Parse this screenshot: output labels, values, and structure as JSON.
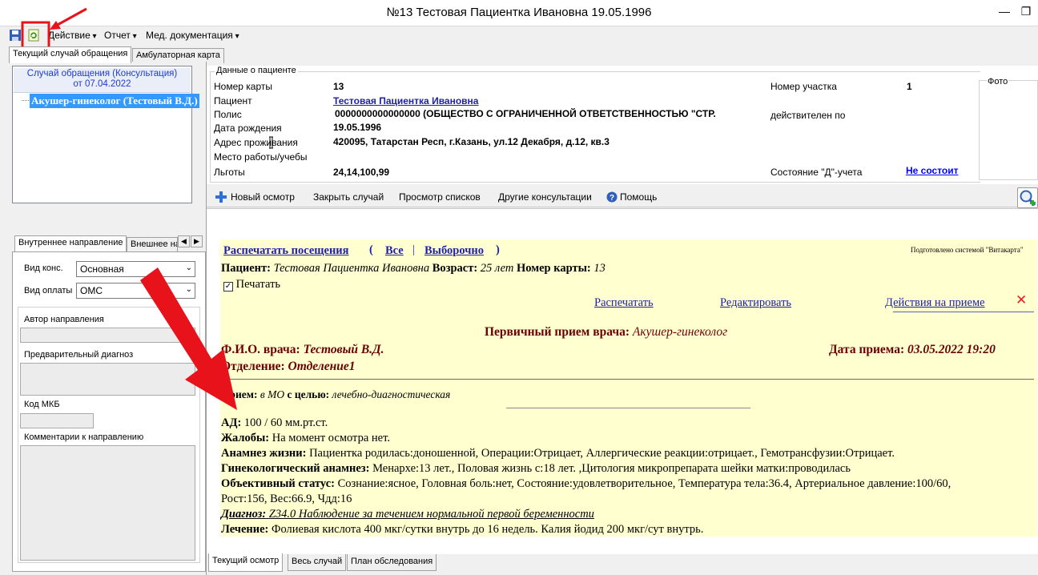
{
  "window": {
    "title": "№13 Тестовая Пациентка Ивановна 19.05.1996",
    "minimize": "—",
    "restore": "❐"
  },
  "menu": {
    "items": [
      "Действие",
      "Отчет",
      "Мед. документация"
    ]
  },
  "main_tabs": [
    "Текущий случай обращения",
    "Амбулаторная карта"
  ],
  "case": {
    "header_line1": "Случай обращения (Консультация)",
    "header_line2": "от 07.04.2022",
    "tree_node": "Акушер-гинеколог (Тестовый В.Д.)"
  },
  "direction_tabs": [
    "Внутреннее направление",
    "Внешнее на"
  ],
  "direction": {
    "kind_label": "Вид конс.",
    "kind_value": "Основная",
    "pay_label": "Вид оплаты",
    "pay_value": "ОМС",
    "author_label": "Автор направления",
    "prelim_diag_label": "Предварительный диагноз",
    "mkb_label": "Код МКБ",
    "comment_label": "Комментарии к направлению"
  },
  "patient": {
    "group_title": "Данные о пациенте",
    "card_label": "Номер карты",
    "card_value": "13",
    "patient_label": "Пациент",
    "patient_value": "Тестовая Пациентка Ивановна",
    "policy_label": "Полис",
    "policy_value": "0000000000000000 (ОБЩЕСТВО С ОГРАНИЧЕННОЙ ОТВЕТСТВЕННОСТЬЮ \"СТР.",
    "dob_label": "Дата рождения",
    "dob_value": "19.05.1996",
    "address_label": "Адрес проживания",
    "address_value": "420095, Татарстан Респ, г.Казань, ул.12 Декабря, д.12, кв.3",
    "work_label": "Место работы/учебы",
    "benefits_label": "Льготы",
    "benefits_value": "24,14,100,99",
    "district_label": "Номер участка",
    "district_value": "1",
    "valid_label": "действителен по",
    "d_label": "Состояние \"Д\"-учета",
    "d_value": "Не состоит",
    "photo_label": "Фото"
  },
  "toolbar": {
    "new_exam": "Новый осмотр",
    "close_case": "Закрыть случай",
    "view_lists": "Просмотр списков",
    "other_consult": "Другие консультации",
    "help": "Помощь"
  },
  "doc": {
    "print_visits": "Распечатать посещения",
    "paren_open": "(",
    "all": "Все",
    "sep": "|",
    "selective": "Выборочно",
    "paren_close": ")",
    "prepared_by": "Подготовлено системой \"Витакарта\"",
    "patient_label": "Пациент:",
    "patient_value": "Тестовая Пациентка Ивановна",
    "age_label": "Возраст:",
    "age_value": "25 лет",
    "card_label": "Номер карты:",
    "card_value": "13",
    "print_checkbox": "Печатать",
    "print_link": "Распечатать",
    "edit_link": "Редактировать",
    "actions_link": "Действия на приеме",
    "close_x": "✕",
    "visit_title": "Первичный прием врача:",
    "visit_specialty": "Акушер-гинеколог",
    "doctor_label": "Ф.И.О. врача:",
    "doctor_value": "Тестовый В.Д.",
    "date_label": "Дата приема:",
    "date_value": "03.05.2022 19:20",
    "dept_label": "Отделение:",
    "dept_value": "Отделение1",
    "reception_label": "Прием:",
    "reception_value": "в МО",
    "goal_label": "с целью:",
    "goal_value": "лечебно-диагностическая",
    "bp_label": "АД:",
    "bp_value": "100 / 60 мм.рт.ст.",
    "complaints_label": "Жалобы:",
    "complaints_value": "На момент осмотра нет.",
    "anamnesis_label": "Анамнез жизни:",
    "anamnesis_value": "Пациентка родилась:доношенной, Операции:Отрицает, Аллергические реакции:отрицает., Гемотрансфузии:Отрицает.",
    "gyn_label": "Гинекологический анамнез:",
    "gyn_value": "Менархе:13 лет., Половая жизнь с:18 лет. ,Цитология микропрепарата шейки матки:проводилась",
    "obj_label": "Объективный статус:",
    "obj_value": "Сознание:ясное, Головная боль:нет, Состояние:удовлетворительное, Температура тела:36.4, Артериальное давление:100/60,",
    "obj_value2": "Рост:156, Вес:66.9, Чдд:16",
    "diag_label": "Диагноз:",
    "diag_value": "Z34.0 Наблюдение за течением нормальной первой беременности",
    "treat_label": "Лечение:",
    "treat_value": "Фолиевая кислота 400 мкг/сутки внутрь до 16 недель. Калия йодид 200 мкг/сут внутрь."
  },
  "bottom_tabs": [
    "Текущий осмотр",
    "Весь случай",
    "План обследования"
  ],
  "colors": {
    "annotation_red": "#e8121b",
    "doc_background": "#ffffd0",
    "maroon": "#6b0000",
    "link_blue": "#1f22a8"
  }
}
